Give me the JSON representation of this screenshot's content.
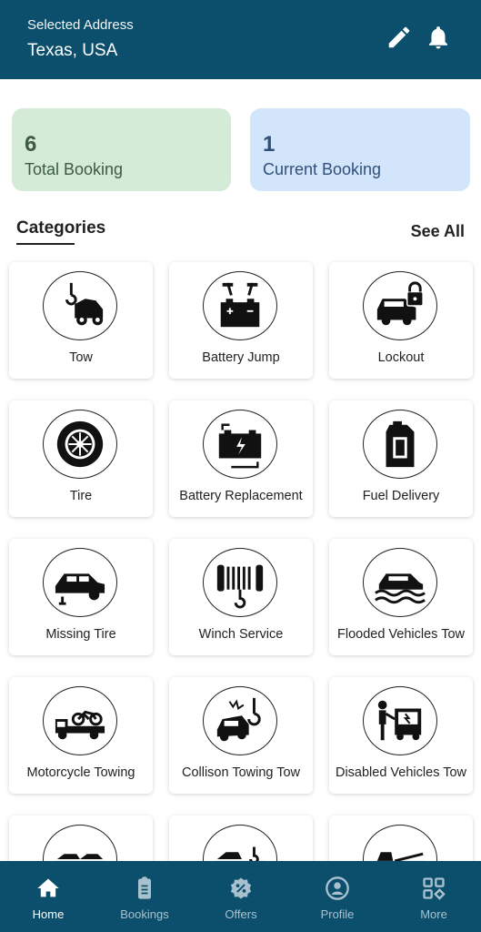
{
  "header": {
    "label": "Selected Address",
    "address": "Texas, USA",
    "background": "#0b4f6c"
  },
  "stats": {
    "total": {
      "value": "6",
      "label": "Total Booking",
      "color": "#d4ebd7"
    },
    "current": {
      "value": "1",
      "label": "Current Booking",
      "color": "#d2e5fb"
    }
  },
  "categories": {
    "title": "Categories",
    "see_all": "See All",
    "items": [
      {
        "label": "Tow",
        "icon": "tow-truck-icon"
      },
      {
        "label": "Battery Jump",
        "icon": "battery-jump-icon"
      },
      {
        "label": "Lockout",
        "icon": "car-lock-icon"
      },
      {
        "label": "Tire",
        "icon": "tire-icon"
      },
      {
        "label": "Battery Replacement",
        "icon": "battery-icon"
      },
      {
        "label": "Fuel Delivery",
        "icon": "fuel-can-icon"
      },
      {
        "label": "Missing Tire",
        "icon": "car-missing-tire-icon"
      },
      {
        "label": "Winch Service",
        "icon": "winch-icon"
      },
      {
        "label": "Flooded Vehicles Tow",
        "icon": "flooded-car-icon"
      },
      {
        "label": "Motorcycle Towing",
        "icon": "motorcycle-tow-icon"
      },
      {
        "label": "Collison Towing Tow",
        "icon": "collision-tow-icon"
      },
      {
        "label": "Disabled Vehicles Tow",
        "icon": "disabled-vehicle-icon"
      },
      {
        "label": "",
        "icon": "car-carrier-icon"
      },
      {
        "label": "",
        "icon": "wrecker-icon"
      },
      {
        "label": "",
        "icon": "flatbed-icon"
      }
    ]
  },
  "nav": {
    "items": [
      {
        "label": "Home",
        "icon": "home-icon",
        "active": true
      },
      {
        "label": "Bookings",
        "icon": "clipboard-icon",
        "active": false
      },
      {
        "label": "Offers",
        "icon": "discount-badge-icon",
        "active": false
      },
      {
        "label": "Profile",
        "icon": "user-icon",
        "active": false
      },
      {
        "label": "More",
        "icon": "grid-icon",
        "active": false
      }
    ]
  }
}
